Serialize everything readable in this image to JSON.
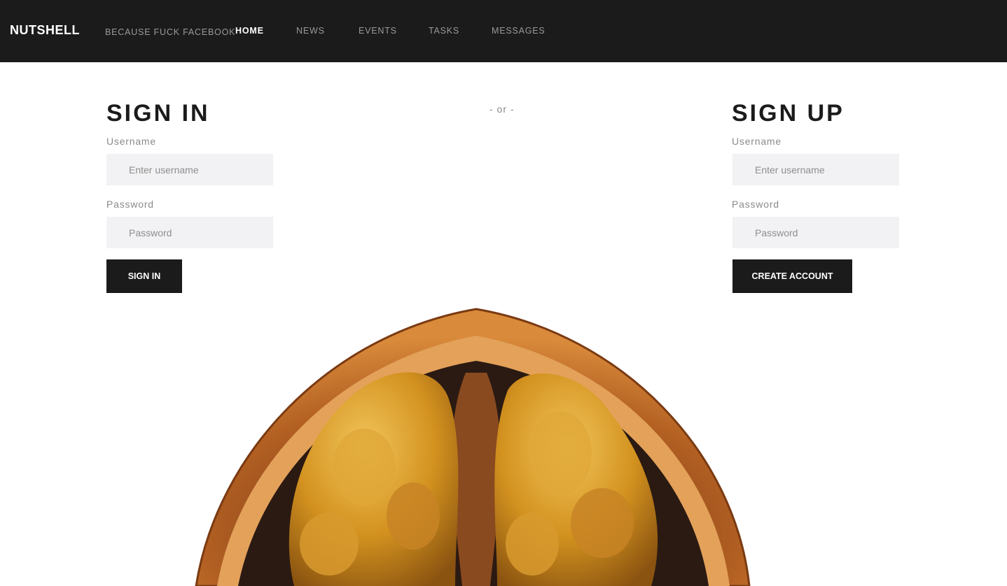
{
  "nav": {
    "brand": "NUTSHELL",
    "tagline": "BECAUSE FUCK FACEBOOK",
    "links": [
      {
        "label": "HOME",
        "active": true
      },
      {
        "label": "NEWS",
        "active": false
      },
      {
        "label": "EVENTS",
        "active": false
      },
      {
        "label": "TASKS",
        "active": false
      },
      {
        "label": "MESSAGES",
        "active": false
      }
    ]
  },
  "separator": "- or -",
  "signin": {
    "title": "SIGN IN",
    "username_label": "Username",
    "username_placeholder": "Enter username",
    "password_label": "Password",
    "password_placeholder": "Password",
    "button_label": "SIGN IN"
  },
  "signup": {
    "title": "SIGN UP",
    "username_label": "Username",
    "username_placeholder": "Enter username",
    "password_label": "Password",
    "password_placeholder": "Password",
    "button_label": "CREATE ACCOUNT"
  },
  "colors": {
    "navbar_bg": "#1b1b1b",
    "input_bg": "#f2f2f4",
    "button_bg": "#1b1b1b",
    "shell": "#c8742a",
    "kernel": "#d69a2a"
  }
}
